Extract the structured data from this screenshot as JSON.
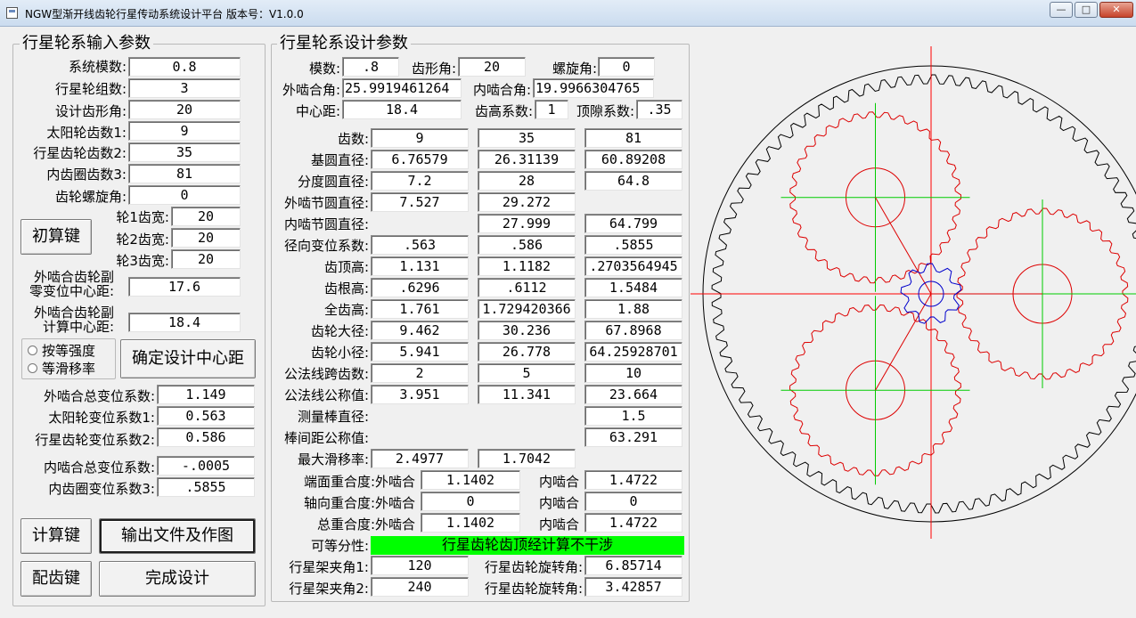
{
  "window": {
    "title": "NGW型渐开线齿轮行星传动系统设计平台 版本号：V1.0.0",
    "min": "0",
    "max": "1",
    "close": "r"
  },
  "input": {
    "legend": "行星轮系输入参数",
    "modulus_label": "系统模数:",
    "modulus": "0.8",
    "groups_label": "行星轮组数:",
    "groups": "3",
    "angle_label": "设计齿形角:",
    "angle": "20",
    "z1_label": "太阳轮齿数1:",
    "z1": "9",
    "z2_label": "行星齿轮齿数2:",
    "z2": "35",
    "z3_label": "内齿圈齿数3:",
    "z3": "81",
    "helix_label": "齿轮螺旋角:",
    "helix": "0",
    "init_button": "初算键",
    "w1_label": "轮1齿宽:",
    "w1": "20",
    "w2_label": "轮2齿宽:",
    "w2": "20",
    "w3_label": "轮3齿宽:",
    "w3": "20",
    "zero_cd_label1": "外啮合齿轮副",
    "zero_cd_label2": "零变位中心距:",
    "zero_cd": "17.6",
    "calc_cd_label1": "外啮合齿轮副",
    "calc_cd_label2": "计算中心距:",
    "calc_cd": "18.4",
    "radio1": "按等强度",
    "radio2": "等滑移率",
    "confirm_cd_button": "确定设计中心距",
    "ext_total_label": "外啮合总变位系数:",
    "ext_total": "1.149",
    "sun_shift_label": "太阳轮变位系数1:",
    "sun_shift": "0.563",
    "planet_shift_label": "行星齿轮变位系数2:",
    "planet_shift": "0.586",
    "int_total_label": "内啮合总变位系数:",
    "int_total": "-.0005",
    "ring_shift_label": "内齿圈变位系数3:",
    "ring_shift": ".5855",
    "calc_button": "计算键",
    "output_button": "输出文件及作图",
    "match_button": "配齿键",
    "finish_button": "完成设计"
  },
  "design": {
    "legend": "行星轮系设计参数",
    "mod_label": "模数:",
    "mod": ".8",
    "pa_label": "齿形角:",
    "pa": "20",
    "helix_label": "螺旋角:",
    "helix": "0",
    "ext_angle_label": "外啮合角:",
    "ext_angle": "25.9919461264",
    "int_angle_label": "内啮合角:",
    "int_angle": "19.9966304765",
    "cd_label": "中心距:",
    "cd": "18.4",
    "addendum_coef_label": "齿高系数:",
    "addendum_coef": "1",
    "clearance_label": "顶隙系数:",
    "clearance": ".35",
    "rows": [
      {
        "label": "齿数:",
        "v1": "9",
        "v2": "35",
        "v3": "81"
      },
      {
        "label": "基圆直径:",
        "v1": "6.76579",
        "v2": "26.31139",
        "v3": "60.89208"
      },
      {
        "label": "分度圆直径:",
        "v1": "7.2",
        "v2": "28",
        "v3": "64.8"
      },
      {
        "label": "外啮节圆直径:",
        "v1": "7.527",
        "v2": "29.272",
        "v3": ""
      },
      {
        "label": "内啮节圆直径:",
        "v1": "",
        "v2": "27.999",
        "v3": "64.799"
      },
      {
        "label": "径向变位系数:",
        "v1": ".563",
        "v2": ".586",
        "v3": ".5855"
      },
      {
        "label": "齿顶高:",
        "v1": "1.131",
        "v2": "1.1182",
        "v3": ".2703564945"
      },
      {
        "label": "齿根高:",
        "v1": ".6296",
        "v2": ".6112",
        "v3": "1.5484"
      },
      {
        "label": "全齿高:",
        "v1": "1.761",
        "v2": "1.729420366",
        "v3": "1.88"
      },
      {
        "label": "齿轮大径:",
        "v1": "9.462",
        "v2": "30.236",
        "v3": "67.8968"
      },
      {
        "label": "齿轮小径:",
        "v1": "5.941",
        "v2": "26.778",
        "v3": "64.25928701"
      },
      {
        "label": "公法线跨齿数:",
        "v1": "2",
        "v2": "5",
        "v3": "10"
      },
      {
        "label": "公法线公称值:",
        "v1": "3.951",
        "v2": "11.341",
        "v3": "23.664"
      },
      {
        "label": "测量棒直径:",
        "v1": "",
        "v2": "",
        "v3": "1.5"
      },
      {
        "label": "棒间距公称值:",
        "v1": "",
        "v2": "",
        "v3": "63.291"
      },
      {
        "label": "最大滑移率:",
        "v1": "2.4977",
        "v2": "1.7042",
        "v3": ""
      }
    ],
    "contact": [
      {
        "label": "端面重合度:外啮合",
        "ext": "1.1402",
        "int_label": "内啮合",
        "int": "1.4722"
      },
      {
        "label": "轴向重合度:外啮合",
        "ext": "0",
        "int_label": "内啮合",
        "int": "0"
      },
      {
        "label": "总重合度:外啮合",
        "ext": "1.1402",
        "int_label": "内啮合",
        "int": "1.4722"
      }
    ],
    "feas_label": "可等分性:",
    "feas_value": "行星齿轮齿顶经计算不干涉",
    "carrier1_label": "行星架夹角1:",
    "carrier1": "120",
    "rot1_label": "行星齿轮旋转角:",
    "rot1": "6.85714",
    "carrier2_label": "行星架夹角2:",
    "carrier2": "240",
    "rot2_label": "行星齿轮旋转角:",
    "rot2": "3.42857"
  },
  "drawing": {
    "sun_teeth": 9,
    "planet_teeth": 35,
    "ring_teeth": 81,
    "planet_angles_deg": [
      0,
      120,
      240
    ],
    "colors": {
      "sun": "#0000cc",
      "planet": "#dd0000",
      "ring": "#000000",
      "axis": "#ff0000",
      "guide": "#00cc00",
      "link": "#dd0000"
    }
  }
}
